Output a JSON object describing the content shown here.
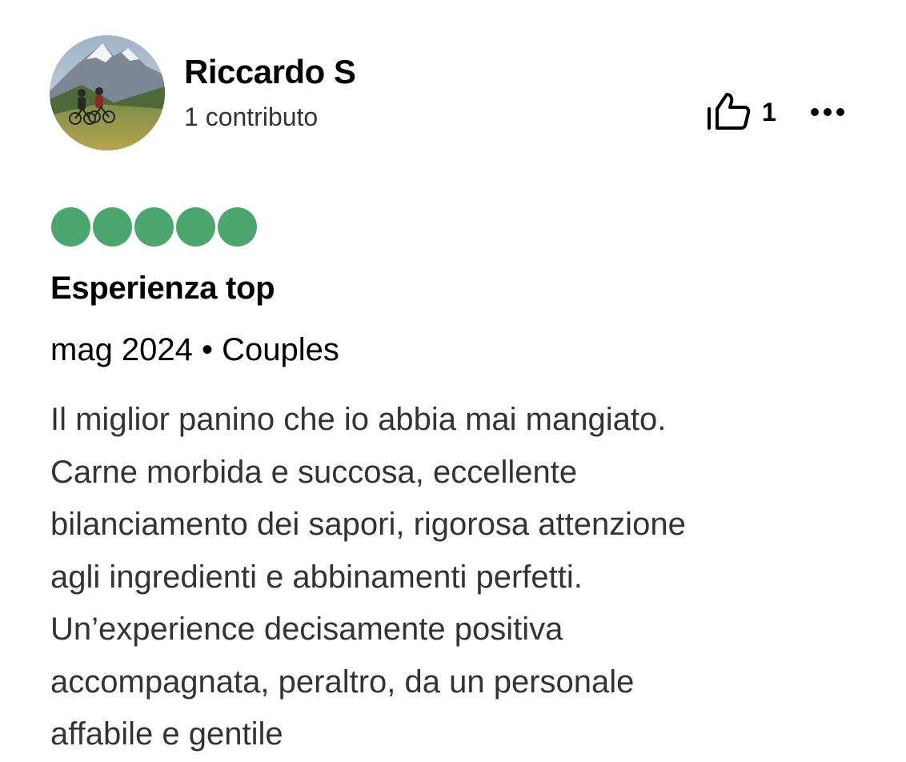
{
  "review": {
    "user": {
      "name": "Riccardo S",
      "contributions": "1 contributo"
    },
    "helpful": {
      "icon": "thumbs-up-icon",
      "count": "1"
    },
    "more_icon": "more-options-icon",
    "rating": {
      "value": 5,
      "max": 5,
      "color": "#4aa66c"
    },
    "title": "Esperienza top",
    "meta": "mag 2024 • Couples",
    "body_lines": [
      "Il miglior panino che io abbia mai mangiato.",
      "Carne morbida e succosa, eccellente",
      "bilanciamento dei sapori, rigorosa attenzione",
      "agli ingredienti e abbinamenti perfetti.",
      "Un’experience decisamente positiva",
      "accompagnata, peraltro, da un personale",
      "affabile e gentile"
    ]
  }
}
